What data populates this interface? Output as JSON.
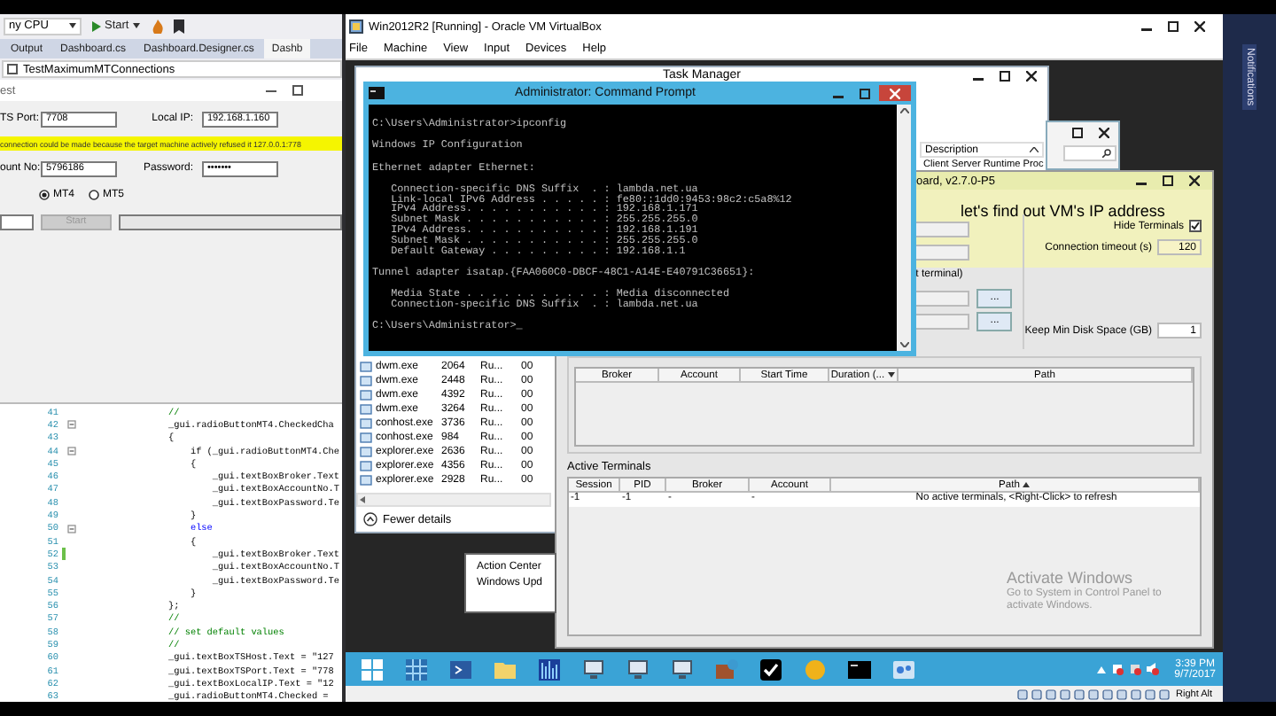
{
  "vs": {
    "config": "ny CPU",
    "start": "Start",
    "tabs": [
      {
        "label": "Output",
        "selected": false
      },
      {
        "label": "Dashboard.cs",
        "selected": false
      },
      {
        "label": "Dashboard.Designer.cs",
        "selected": false
      },
      {
        "label": "Dashb",
        "selected": true
      }
    ],
    "member": "TestMaximumMTConnections",
    "form": {
      "title": "est",
      "row1": [
        {
          "label": "TS Port:",
          "value": "7708"
        },
        {
          "label": "Local IP:",
          "value": "192.168.1.160"
        }
      ],
      "error": "connection could be made because the target machine actively refused it 127.0.0.1:778",
      "row2": [
        {
          "label": "ount No:",
          "value": "5796186"
        },
        {
          "label": "Password:",
          "value": "•••••••"
        }
      ],
      "radios": [
        {
          "label": "MT4",
          "selected": true
        },
        {
          "label": "MT5",
          "selected": false
        }
      ],
      "start": {
        "label": "Start",
        "disabled": true
      }
    },
    "code": [
      {
        "number": "41",
        "text": "//",
        "kind": "comment",
        "collapsible": false,
        "changed": false
      },
      {
        "number": "42",
        "text": "_gui.radioButtonMT4.CheckedCha",
        "kind": "code",
        "collapsible": true,
        "changed": false
      },
      {
        "number": "43",
        "text": "{",
        "kind": "code",
        "collapsible": false,
        "changed": false
      },
      {
        "number": "44",
        "text": "    if (_gui.radioButtonMT4.Che",
        "kind": "code",
        "collapsible": true,
        "changed": false
      },
      {
        "number": "45",
        "text": "    {",
        "kind": "code",
        "collapsible": false,
        "changed": false
      },
      {
        "number": "46",
        "text": "        _gui.textBoxBroker.Text",
        "kind": "code",
        "collapsible": false,
        "changed": false
      },
      {
        "number": "47",
        "text": "        _gui.textBoxAccountNo.T",
        "kind": "code",
        "collapsible": false,
        "changed": false
      },
      {
        "number": "48",
        "text": "        _gui.textBoxPassword.Te",
        "kind": "code",
        "collapsible": false,
        "changed": false
      },
      {
        "number": "49",
        "text": "    }",
        "kind": "code",
        "collapsible": false,
        "changed": false
      },
      {
        "number": "50",
        "text": "    else",
        "kind": "keyword",
        "collapsible": true,
        "changed": false
      },
      {
        "number": "51",
        "text": "    {",
        "kind": "code",
        "collapsible": false,
        "changed": false
      },
      {
        "number": "52",
        "text": "        _gui.textBoxBroker.Text",
        "kind": "code",
        "collapsible": false,
        "changed": true
      },
      {
        "number": "53",
        "text": "        _gui.textBoxAccountNo.T",
        "kind": "code",
        "collapsible": false,
        "changed": false
      },
      {
        "number": "54",
        "text": "        _gui.textBoxPassword.Te",
        "kind": "code",
        "collapsible": false,
        "changed": false
      },
      {
        "number": "55",
        "text": "    }",
        "kind": "code",
        "collapsible": false,
        "changed": false
      },
      {
        "number": "56",
        "text": "};",
        "kind": "code",
        "collapsible": false,
        "changed": false
      },
      {
        "number": "57",
        "text": "//",
        "kind": "comment",
        "collapsible": false,
        "changed": false
      },
      {
        "number": "58",
        "text": "// set default values",
        "kind": "comment",
        "collapsible": false,
        "changed": false
      },
      {
        "number": "59",
        "text": "//",
        "kind": "comment",
        "collapsible": false,
        "changed": false
      },
      {
        "number": "60",
        "text": "_gui.textBoxTSHost.Text = \"127",
        "kind": "code",
        "collapsible": false,
        "changed": false
      },
      {
        "number": "61",
        "text": "_gui.textBoxTSPort.Text = \"778",
        "kind": "code",
        "collapsible": false,
        "changed": false
      },
      {
        "number": "62",
        "text": "_gui.textBoxLocalIP.Text = \"12",
        "kind": "code",
        "collapsible": false,
        "changed": false
      },
      {
        "number": "63",
        "text": "_gui.radioButtonMT4.Checked = ",
        "kind": "code",
        "collapsible": false,
        "changed": false
      }
    ]
  },
  "notifications": "Notifications",
  "vbox": {
    "title": "Win2012R2 [Running] - Oracle VM VirtualBox",
    "menu": [
      "File",
      "Machine",
      "View",
      "Input",
      "Devices",
      "Help"
    ],
    "task_manager": {
      "title": "Task Manager",
      "description_header": "Description",
      "description_row": "Client Server Runtime Proc",
      "processes": [
        {
          "name": "dwm.exe",
          "pid": "2064",
          "status": "Ru...",
          "cpu": "00"
        },
        {
          "name": "dwm.exe",
          "pid": "2448",
          "status": "Ru...",
          "cpu": "00"
        },
        {
          "name": "dwm.exe",
          "pid": "4392",
          "status": "Ru...",
          "cpu": "00"
        },
        {
          "name": "dwm.exe",
          "pid": "3264",
          "status": "Ru...",
          "cpu": "00"
        },
        {
          "name": "conhost.exe",
          "pid": "3736",
          "status": "Ru...",
          "cpu": "00"
        },
        {
          "name": "conhost.exe",
          "pid": "984",
          "status": "Ru...",
          "cpu": "00"
        },
        {
          "name": "explorer.exe",
          "pid": "2636",
          "status": "Ru...",
          "cpu": "00"
        },
        {
          "name": "explorer.exe",
          "pid": "4356",
          "status": "Ru...",
          "cpu": "00"
        },
        {
          "name": "explorer.exe",
          "pid": "2928",
          "status": "Ru...",
          "cpu": "00"
        }
      ],
      "fewer_details": "Fewer details"
    },
    "cmd": {
      "title": "Administrator: Command Prompt",
      "blocks": [
        [
          "C:\\Users\\Administrator>ipconfig"
        ],
        [
          "Windows IP Configuration"
        ],
        [
          "Ethernet adapter Ethernet:"
        ],
        [
          "   Connection-specific DNS Suffix  . : lambda.net.ua",
          "   Link-local IPv6 Address . . . . . : fe80::1dd0:9453:98c2:c5a8%12",
          "   IPv4 Address. . . . . . . . . . . : 192.168.1.171",
          "   Subnet Mask . . . . . . . . . . . : 255.255.255.0",
          "   IPv4 Address. . . . . . . . . . . : 192.168.1.191",
          "   Subnet Mask . . . . . . . . . . . : 255.255.255.0",
          "   Default Gateway . . . . . . . . . : 192.168.1.1"
        ],
        [
          "Tunnel adapter isatap.{FAA060C0-DBCF-48C1-A14E-E40791C36651}:"
        ],
        [
          "   Media State . . . . . . . . . . . : Media disconnected",
          "   Connection-specific DNS Suffix  . : lambda.net.ua"
        ],
        [
          "C:\\Users\\Administrator>_"
        ]
      ]
    },
    "dashboard": {
      "title": "oard, v2.7.0-P5",
      "heading": "let's find out VM's IP address",
      "hide_terminals": {
        "label": "Hide Terminals",
        "checked": true
      },
      "timeout": {
        "label": "Connection timeout (s)",
        "value": "120"
      },
      "terminal_hint": "t terminal)",
      "browse_buttons": [
        "...",
        "..."
      ],
      "disk": {
        "label": "Keep Min Disk Space (GB)",
        "value": "1"
      },
      "table": {
        "columns": [
          {
            "label": "Broker",
            "dropdown": false
          },
          {
            "label": "Account",
            "dropdown": false
          },
          {
            "label": "Start Time",
            "dropdown": false
          },
          {
            "label": "Duration (...",
            "dropdown": true
          },
          {
            "label": "Path",
            "dropdown": false
          }
        ]
      },
      "active": {
        "title": "Active Terminals",
        "columns": [
          {
            "label": "Session",
            "sorted": false
          },
          {
            "label": "PID",
            "sorted": false
          },
          {
            "label": "Broker",
            "sorted": false
          },
          {
            "label": "Account",
            "sorted": false
          },
          {
            "label": "Path",
            "sorted": true
          }
        ],
        "rows": [
          [
            "-1",
            "-1",
            "-",
            "-",
            "No active terminals, <Right-Click> to refresh"
          ]
        ]
      }
    },
    "action_center": [
      "Action Center",
      "Windows Upd"
    ],
    "activation": {
      "title": "Activate Windows",
      "lines": [
        "Go to System in Control Panel to",
        "activate Windows."
      ]
    },
    "clock": {
      "time": "3:39 PM",
      "date": "9/7/2017"
    },
    "status_bar": {
      "host_key": "Right Alt"
    }
  }
}
